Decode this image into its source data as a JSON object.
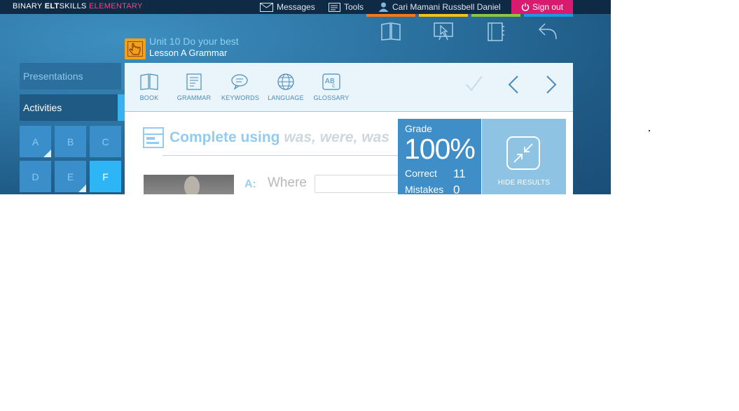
{
  "brand": {
    "part1": "BINARY ",
    "part2": "ELT",
    "part3": "SKILLS ",
    "part4": "ELEMENTARY"
  },
  "topnav": {
    "messages": "Messages",
    "tools": "Tools",
    "user": "Cari Mamani Russbell Daniel",
    "signout": "Sign out"
  },
  "colors": {
    "stripe1": "#f07a1c",
    "stripe2": "#f5c01a",
    "stripe3": "#8cc63f",
    "stripe4": "#1e9be0",
    "signout": "#d81b6e",
    "accent": "#36b3ee"
  },
  "header": {
    "unit": "Unit 10 Do your best",
    "lesson": "Lesson A Grammar"
  },
  "header_icons": [
    "book-icon",
    "interactive-board-icon",
    "notebook-icon",
    "back-arrow-icon"
  ],
  "sidebar": {
    "presentations": "Presentations",
    "activities": "Activities",
    "tiles": [
      {
        "label": "A",
        "done": true
      },
      {
        "label": "B",
        "done": false
      },
      {
        "label": "C",
        "done": false
      },
      {
        "label": "D",
        "done": false
      },
      {
        "label": "E",
        "done": true
      },
      {
        "label": "F",
        "done": false,
        "active": true
      }
    ]
  },
  "toolbar": {
    "book": "BOOK",
    "grammar": "GRAMMAR",
    "keywords": "KEYWORDS",
    "language": "LANGUAGE",
    "glossary": "GLOSSARY"
  },
  "exercise": {
    "title_prefix": "Complete using ",
    "title_italic": "was, were, was",
    "speaker": "A:",
    "word": "Where"
  },
  "results": {
    "grade_label": "Grade",
    "grade_value": "100%",
    "correct_label": "Correct",
    "correct_value": "11",
    "mistakes_label": "Mistakes",
    "mistakes_value": "0",
    "hide_label": "HIDE RESULTS"
  }
}
